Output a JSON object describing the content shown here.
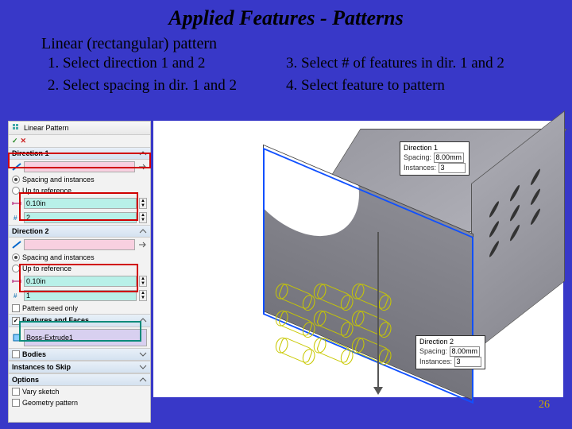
{
  "title": "Applied Features - Patterns",
  "subtitle": "Linear (rectangular) pattern",
  "steps": {
    "s1": "1.   Select direction 1 and 2",
    "s2": "2.   Select spacing in dir. 1 and 2",
    "s3": "3.   Select # of features in dir. 1 and 2",
    "s4": "4.   Select feature to pattern"
  },
  "page_number": "26",
  "panel": {
    "title": "Linear Pattern",
    "dir1": {
      "header": "Direction 1",
      "opt_spacing": "Spacing and instances",
      "opt_ref": "Up to reference",
      "spacing": "0.10in",
      "count": "2"
    },
    "dir2": {
      "header": "Direction 2",
      "opt_spacing": "Spacing and instances",
      "opt_ref": "Up to reference",
      "spacing": "0.10in",
      "count": "1",
      "seed_only": "Pattern seed only"
    },
    "features": {
      "header": "Features and Faces",
      "item": "Boss-Extrude1"
    },
    "bodies": {
      "header": "Bodies"
    },
    "skip": {
      "header": "Instances to Skip"
    },
    "options": {
      "header": "Options",
      "vary": "Vary sketch",
      "geom": "Geometry pattern"
    }
  },
  "callouts": {
    "d1": {
      "title": "Direction 1",
      "spacing_lbl": "Spacing:",
      "spacing_val": "8.00mm",
      "inst_lbl": "Instances:",
      "inst_val": "3"
    },
    "d2": {
      "title": "Direction 2",
      "spacing_lbl": "Spacing:",
      "spacing_val": "8.00mm",
      "inst_lbl": "Instances:",
      "inst_val": "3"
    }
  }
}
